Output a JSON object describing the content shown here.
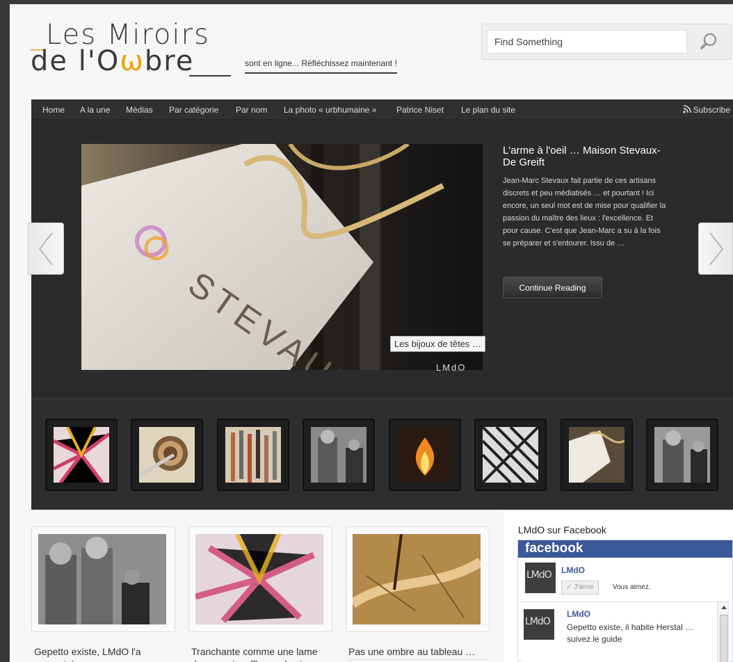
{
  "header": {
    "logo_line1_prefix": "_",
    "logo_line1_text": "Les Miroirs",
    "logo_line2_a": "de l'O",
    "logo_line2_accent": "ω",
    "logo_line2_b": "bre",
    "tagline": "sont en ligne... Réfléchissez maintenant !",
    "search_placeholder": "Find Something",
    "search_icon": "magnifier-icon"
  },
  "nav": {
    "items": [
      "Home",
      "A la une",
      "Médias",
      "Par catégorie",
      "Par nom",
      "La photo « urbhumaine »",
      "Patrice Niset",
      "Le plan du site"
    ],
    "subscribe": "Subscribe"
  },
  "slider": {
    "title": "L'arme à l'oeil … Maison Stevaux- De Greift",
    "excerpt": "Jean-Marc Stevaux fait partie de ces artisans discrets et peu médiatisés … et pourtant ! Ici encore, un seul mot est de mise pour qualifier la passion du maître des lieux : l'excellence. Et pour cause. C'est que Jean-Marc a su à la fois se préparer et s'entourer. Issu de …",
    "button": "Continue Reading",
    "caption": "Les bijoux de têtes …",
    "watermark": "LMdO"
  },
  "posts": [
    {
      "title": "Gepetto existe, LMdO l'a rencontré"
    },
    {
      "title": "Tranchante comme une lame de verre, insuffleuse de vie"
    },
    {
      "title": "Pas une ombre au tableau …"
    }
  ],
  "sidebar": {
    "title": "LMdO sur Facebook",
    "fb_brand": "facebook",
    "page_name": "LMdO",
    "logo_text": "LMdO",
    "like_label": "✓ J'aime",
    "likes_text": "Vous aimez.",
    "post_name": "LMdO",
    "post_text": "Gepetto existe, il habite Herstal … suivez le guide"
  },
  "colors": {
    "accent": "#e8a20c",
    "fb_blue": "#3b5998",
    "dark_bg": "#2b2b2b"
  }
}
